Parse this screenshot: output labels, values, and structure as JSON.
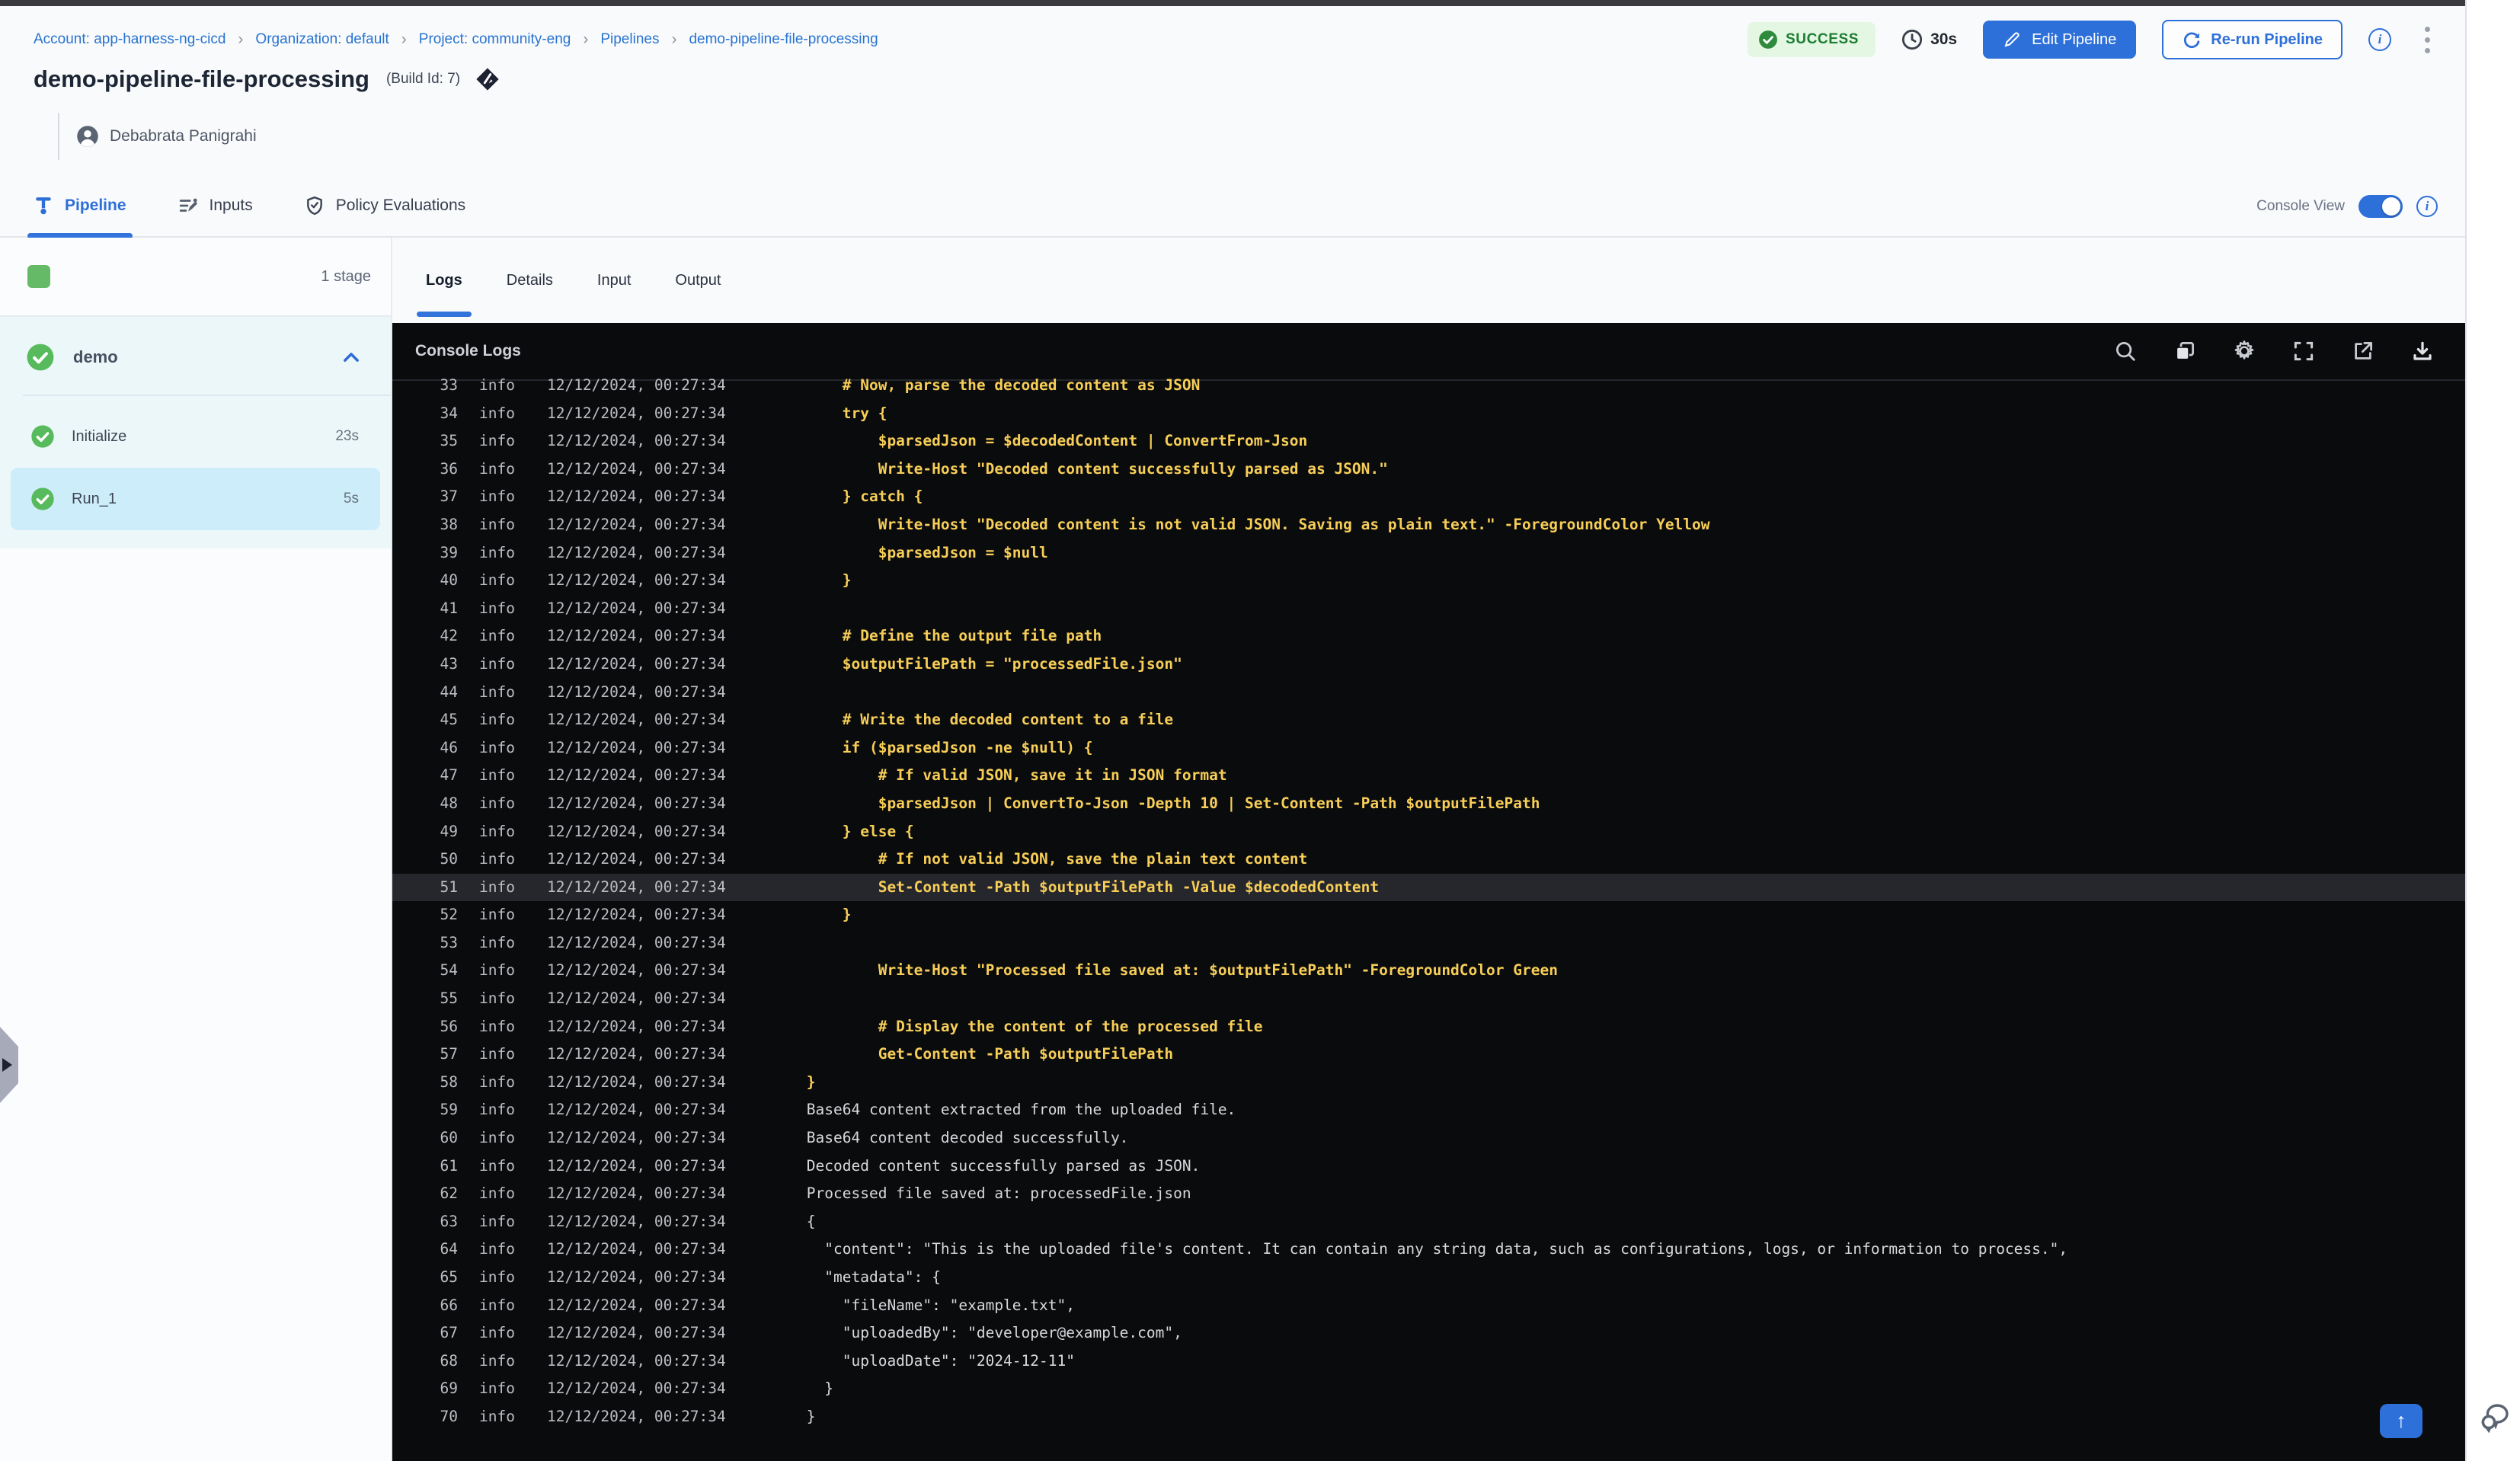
{
  "breadcrumb": {
    "items": [
      "Account: app-harness-ng-cicd",
      "Organization: default",
      "Project: community-eng",
      "Pipelines",
      "demo-pipeline-file-processing"
    ]
  },
  "header": {
    "title": "demo-pipeline-file-processing",
    "build_id": "(Build Id: 7)",
    "author": "Debabrata Panigrahi",
    "status": "SUCCESS",
    "duration": "30s",
    "edit_button": "Edit Pipeline",
    "rerun_button": "Re-run Pipeline"
  },
  "tabs": {
    "pipeline": "Pipeline",
    "inputs": "Inputs",
    "policy": "Policy Evaluations",
    "console_view_label": "Console View",
    "console_view_on": true
  },
  "sidebar": {
    "stage_count": "1 stage",
    "stage_name": "demo",
    "steps": [
      {
        "name": "Initialize",
        "duration": "23s",
        "selected": false
      },
      {
        "name": "Run_1",
        "duration": "5s",
        "selected": true
      }
    ]
  },
  "console": {
    "tabs": [
      "Logs",
      "Details",
      "Input",
      "Output"
    ],
    "active_tab": "Logs",
    "title": "Console Logs",
    "icons": [
      "search-icon",
      "copy-icon",
      "settings-icon",
      "fullscreen-icon",
      "open-in-new-icon",
      "download-icon"
    ],
    "level": "info",
    "timestamp": "12/12/2024, 00:27:34",
    "lines": [
      {
        "n": 33,
        "c": "y",
        "m": "    # Now, parse the decoded content as JSON"
      },
      {
        "n": 34,
        "c": "y",
        "m": "    try {"
      },
      {
        "n": 35,
        "c": "y",
        "m": "        $parsedJson = $decodedContent | ConvertFrom-Json"
      },
      {
        "n": 36,
        "c": "y",
        "m": "        Write-Host \"Decoded content successfully parsed as JSON.\""
      },
      {
        "n": 37,
        "c": "y",
        "m": "    } catch {"
      },
      {
        "n": 38,
        "c": "y",
        "m": "        Write-Host \"Decoded content is not valid JSON. Saving as plain text.\" -ForegroundColor Yellow"
      },
      {
        "n": 39,
        "c": "y",
        "m": "        $parsedJson = $null"
      },
      {
        "n": 40,
        "c": "y",
        "m": "    }"
      },
      {
        "n": 41,
        "c": "y",
        "m": ""
      },
      {
        "n": 42,
        "c": "y",
        "m": "    # Define the output file path"
      },
      {
        "n": 43,
        "c": "y",
        "m": "    $outputFilePath = \"processedFile.json\""
      },
      {
        "n": 44,
        "c": "y",
        "m": ""
      },
      {
        "n": 45,
        "c": "y",
        "m": "    # Write the decoded content to a file"
      },
      {
        "n": 46,
        "c": "y",
        "m": "    if ($parsedJson -ne $null) {"
      },
      {
        "n": 47,
        "c": "y",
        "m": "        # If valid JSON, save it in JSON format"
      },
      {
        "n": 48,
        "c": "y",
        "m": "        $parsedJson | ConvertTo-Json -Depth 10 | Set-Content -Path $outputFilePath"
      },
      {
        "n": 49,
        "c": "y",
        "m": "    } else {"
      },
      {
        "n": 50,
        "c": "y",
        "m": "        # If not valid JSON, save the plain text content"
      },
      {
        "n": 51,
        "c": "y",
        "m": "        Set-Content -Path $outputFilePath -Value $decodedContent",
        "hl": true
      },
      {
        "n": 52,
        "c": "y",
        "m": "    }"
      },
      {
        "n": 53,
        "c": "y",
        "m": ""
      },
      {
        "n": 54,
        "c": "y",
        "m": "        Write-Host \"Processed file saved at: $outputFilePath\" -ForegroundColor Green"
      },
      {
        "n": 55,
        "c": "y",
        "m": ""
      },
      {
        "n": 56,
        "c": "y",
        "m": "        # Display the content of the processed file"
      },
      {
        "n": 57,
        "c": "y",
        "m": "        Get-Content -Path $outputFilePath"
      },
      {
        "n": 58,
        "c": "y",
        "m": "}"
      },
      {
        "n": 59,
        "c": "w",
        "m": "Base64 content extracted from the uploaded file."
      },
      {
        "n": 60,
        "c": "w",
        "m": "Base64 content decoded successfully."
      },
      {
        "n": 61,
        "c": "w",
        "m": "Decoded content successfully parsed as JSON."
      },
      {
        "n": 62,
        "c": "w",
        "m": "Processed file saved at: processedFile.json"
      },
      {
        "n": 63,
        "c": "w",
        "m": "{"
      },
      {
        "n": 64,
        "c": "w",
        "m": "  \"content\": \"This is the uploaded file's content. It can contain any string data, such as configurations, logs, or information to process.\","
      },
      {
        "n": 65,
        "c": "w",
        "m": "  \"metadata\": {"
      },
      {
        "n": 66,
        "c": "w",
        "m": "    \"fileName\": \"example.txt\","
      },
      {
        "n": 67,
        "c": "w",
        "m": "    \"uploadedBy\": \"developer@example.com\","
      },
      {
        "n": 68,
        "c": "w",
        "m": "    \"uploadDate\": \"2024-12-11\""
      },
      {
        "n": 69,
        "c": "w",
        "m": "  }"
      },
      {
        "n": 70,
        "c": "w",
        "m": "}"
      }
    ]
  },
  "colors": {
    "primary_blue": "#2e70d9",
    "link_blue": "#2874d0",
    "success_green": "#57ba5c",
    "log_yellow": "#f7ce58",
    "console_bg": "#0a0b0d",
    "stage_section_bg": "#ecf7fa",
    "selected_step_bg": "#cdedfa"
  }
}
